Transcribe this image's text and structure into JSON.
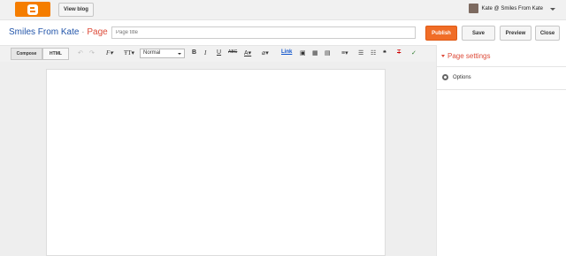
{
  "top": {
    "view_blog": "View blog",
    "user": "Kate @ Smiles From Kate"
  },
  "header": {
    "blog_name": "Smiles From Kate",
    "separator": "·",
    "page_label": "Page",
    "title_placeholder": "Page title",
    "publish": "Publish",
    "save": "Save",
    "preview": "Preview",
    "close": "Close"
  },
  "toolbar": {
    "compose": "Compose",
    "html": "HTML",
    "font_size": "Normal",
    "bold": "B",
    "italic": "I",
    "underline": "U",
    "strike": "ABC",
    "link": "Link"
  },
  "panel": {
    "title": "Page settings",
    "options": "Options"
  }
}
